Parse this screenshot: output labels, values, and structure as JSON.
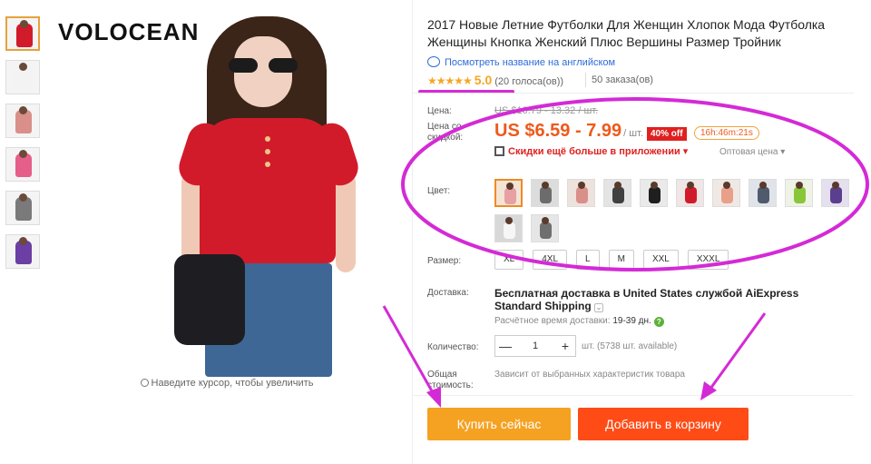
{
  "brand": "VOLOCEAN",
  "zoom_hint": "Наведите курсор, чтобы увеличить",
  "thumbnails": [
    {
      "name": "red",
      "color": "#d21b2a"
    },
    {
      "name": "white",
      "color": "#f3f3f3"
    },
    {
      "name": "pink",
      "color": "#d98f8a"
    },
    {
      "name": "rose",
      "color": "#e55f8a"
    },
    {
      "name": "gray",
      "color": "#7a7a7a"
    },
    {
      "name": "purple",
      "color": "#6b3fa3"
    }
  ],
  "product": {
    "title": "2017 Новые Летние Футболки Для Женщин Хлопок Мода Футболка Женщины Кнопка Женский Плюс Вершины Размер Тройник",
    "translate_link": "Посмотреть название на английском",
    "stars": "★★★★★",
    "rating": "5.0",
    "votes": "(20 голоса(ов))",
    "orders": "50 заказа(ов)"
  },
  "price": {
    "label": "Цена:",
    "old": "US $10.79 - 13.32 / шт.",
    "discount_label": "Цена со скидкой:",
    "new": "US $6.59 - 7.99",
    "per": "/ шт.",
    "discount_badge": "40% off",
    "timer": "16h:46m:21s",
    "app_promo": "Скидки ещё больше в приложении ▾",
    "wholesale": "Оптовая цена ▾"
  },
  "color": {
    "label": "Цвет:",
    "swatches": [
      {
        "shirt": "#e7a0a3",
        "bg": "#f3e4d6"
      },
      {
        "shirt": "#6c6c6c",
        "bg": "#dcdcdc"
      },
      {
        "shirt": "#d98f8a",
        "bg": "#eee2dc"
      },
      {
        "shirt": "#404040",
        "bg": "#e4e4e4"
      },
      {
        "shirt": "#1f1f1f",
        "bg": "#eaeaea"
      },
      {
        "shirt": "#d21b2a",
        "bg": "#efe6e6"
      },
      {
        "shirt": "#e8a08a",
        "bg": "#f0e8e4"
      },
      {
        "shirt": "#4f5b6d",
        "bg": "#e0e4ea"
      },
      {
        "shirt": "#8ac63a",
        "bg": "#eef3e6"
      },
      {
        "shirt": "#5a3f8e",
        "bg": "#e4e0ee"
      },
      {
        "shirt": "#f6f6f6",
        "bg": "#d8d8d8"
      },
      {
        "shirt": "#6f6f6f",
        "bg": "#e6e6e6"
      }
    ]
  },
  "size": {
    "label": "Размер:",
    "options": [
      "XL",
      "4XL",
      "L",
      "M",
      "XXL",
      "XXXL"
    ]
  },
  "shipping": {
    "label": "Доставка:",
    "title": "Бесплатная доставка в United States службой AiExpress Standard Shipping",
    "chevron": "⌄",
    "time_label": "Расчётное время доставки:",
    "time_value": "19-39 дн.",
    "help": "?"
  },
  "quantity": {
    "label": "Количество:",
    "value": "1",
    "minus": "—",
    "plus": "+",
    "stock": "шт. (5738 шт. available)"
  },
  "total": {
    "label": "Общая стоимость:",
    "note": "Зависит от выбранных характеристик товара"
  },
  "actions": {
    "buy_now": "Купить сейчас",
    "add_to_cart": "Добавить в корзину"
  },
  "colors": {
    "annotation": "#d42ad6",
    "price": "#ee5a1c",
    "buy": "#f5a122",
    "cart": "#ff4b16",
    "star": "#f5a623"
  }
}
